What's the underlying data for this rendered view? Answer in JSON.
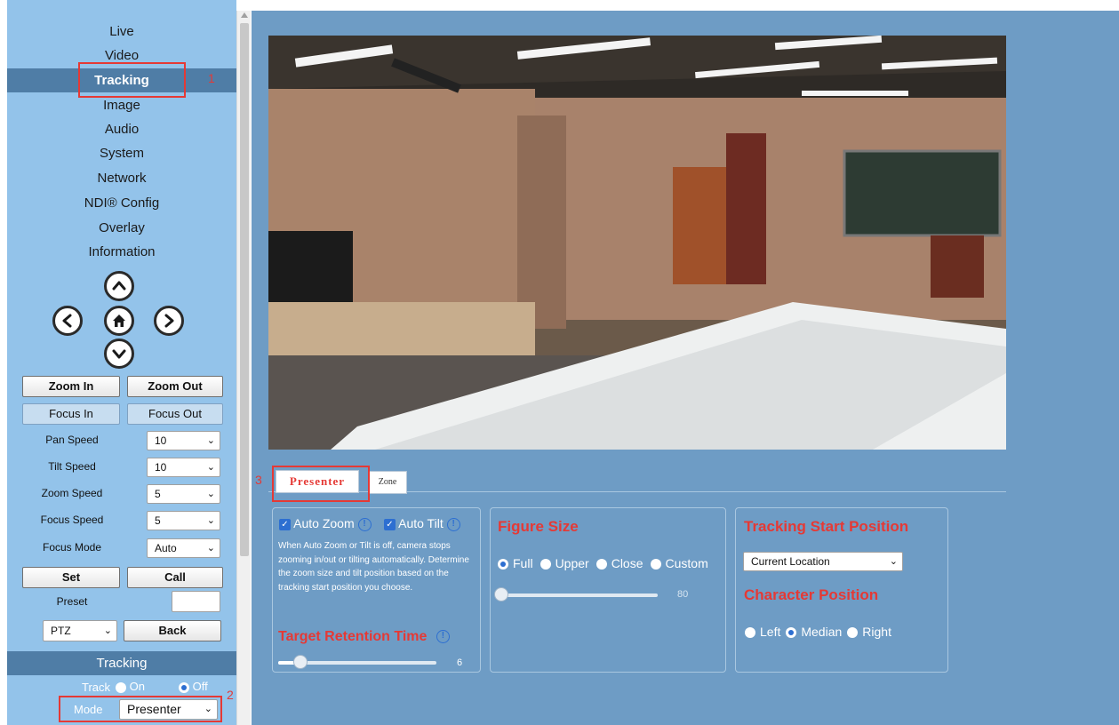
{
  "nav": {
    "items": [
      "Live",
      "Video",
      "Tracking",
      "Image",
      "Audio",
      "System",
      "Network",
      "NDI® Config",
      "Overlay",
      "Information"
    ],
    "active": "Tracking",
    "annotation": "1"
  },
  "ptz": {
    "up_icon": "chevron-up-icon",
    "left_icon": "chevron-left-icon",
    "home_icon": "home-icon",
    "right_icon": "chevron-right-icon",
    "down_icon": "chevron-down-icon"
  },
  "controls": {
    "zoom_in": "Zoom In",
    "zoom_out": "Zoom Out",
    "focus_in": "Focus In",
    "focus_out": "Focus Out",
    "pan_speed_label": "Pan Speed",
    "pan_speed_value": "10",
    "tilt_speed_label": "Tilt Speed",
    "tilt_speed_value": "10",
    "zoom_speed_label": "Zoom Speed",
    "zoom_speed_value": "5",
    "focus_speed_label": "Focus Speed",
    "focus_speed_value": "5",
    "focus_mode_label": "Focus Mode",
    "focus_mode_value": "Auto",
    "set": "Set",
    "call": "Call",
    "preset_label": "Preset",
    "preset_value": "",
    "ptz_select": "PTZ",
    "back": "Back"
  },
  "tracking_section": {
    "header": "Tracking",
    "track_label": "Track",
    "on_label": "On",
    "off_label": "Off",
    "track_state": "Off",
    "mode_label": "Mode",
    "mode_value": "Presenter",
    "annotation": "2"
  },
  "tabs": {
    "presenter": "Presenter",
    "zone": "Zone",
    "active": "Presenter",
    "annotation": "3"
  },
  "auto_panel": {
    "auto_zoom": "Auto Zoom",
    "auto_tilt": "Auto Tilt",
    "auto_zoom_checked": true,
    "auto_tilt_checked": true,
    "description": "When Auto Zoom or Tilt is off, camera stops zooming in/out or tilting automatically. Determine the zoom size and tilt position based on the tracking start position you choose.",
    "retention_title": "Target Retention Time",
    "retention_value": "6",
    "retention_fraction": 0.12
  },
  "figure_panel": {
    "title": "Figure Size",
    "options": [
      "Full",
      "Upper",
      "Close",
      "Custom"
    ],
    "selected": "Full",
    "slider_value": "80",
    "slider_fraction": 0.0
  },
  "start_panel": {
    "title": "Tracking Start Position",
    "location_value": "Current Location",
    "character_title": "Character Position",
    "options": [
      "Left",
      "Median",
      "Right"
    ],
    "selected": "Median"
  },
  "colors": {
    "sidebar": "#93c3ea",
    "nav_active": "#4f7da6",
    "main_bg": "#6e9cc5",
    "accent_red": "#e53935",
    "accent_blue": "#2d6fd1"
  }
}
